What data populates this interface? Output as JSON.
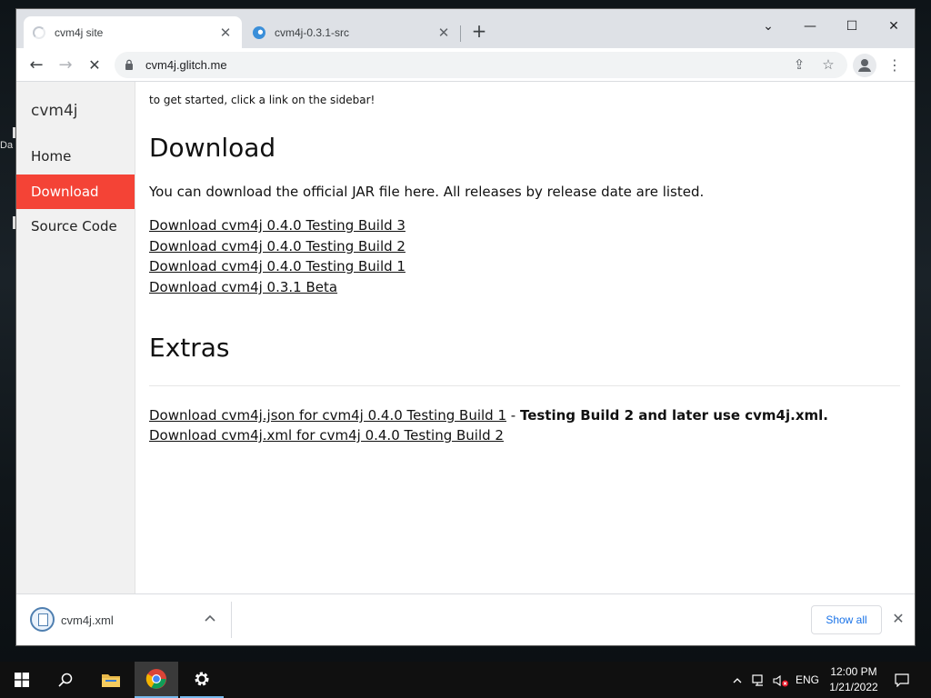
{
  "desktop": {
    "icon_label_fragment": "Da"
  },
  "browser": {
    "tabs": [
      {
        "title": "cvm4j site",
        "icon": "loading-spinner-icon",
        "close": "✕"
      },
      {
        "title": "cvm4j-0.3.1-src",
        "icon": "edge-icon",
        "close": "✕"
      }
    ],
    "new_tab": "+",
    "window_controls": {
      "tab_search": "⌄",
      "minimize": "—",
      "maximize": "☐",
      "close": "✕"
    },
    "nav": {
      "back": "←",
      "forward": "→",
      "stop": "✕"
    },
    "url": "cvm4j.glitch.me",
    "share_icon": "⇪",
    "star_icon": "☆",
    "menu_icon": "⋮"
  },
  "page": {
    "sidebar": {
      "brand": "cvm4j",
      "items": [
        {
          "label": "Home",
          "active": false
        },
        {
          "label": "Download",
          "active": true
        },
        {
          "label": "Source Code",
          "active": false
        }
      ],
      "active_color": "#f44336"
    },
    "intro": "to get started, click a link on the sidebar!",
    "download": {
      "heading": "Download",
      "text": "You can download the official JAR file here. All releases by release date are listed.",
      "links": [
        "Download cvm4j 0.4.0 Testing Build 3",
        "Download cvm4j 0.4.0 Testing Build 2",
        "Download cvm4j 0.4.0 Testing Build 1",
        "Download cvm4j 0.3.1 Beta"
      ]
    },
    "extras": {
      "heading": "Extras",
      "json_link": "Download cvm4j.json for cvm4j 0.4.0 Testing Build 1",
      "separator": " - ",
      "note": "Testing Build 2 and later use cvm4j.xml.",
      "xml_link": "Download cvm4j.xml for cvm4j 0.4.0 Testing Build 2"
    }
  },
  "download_shelf": {
    "file_name": "cvm4j.xml",
    "chevron": "^",
    "show_all": "Show all",
    "close": "✕"
  },
  "taskbar": {
    "language": "ENG",
    "time": "12:00 PM",
    "date": "1/21/2022",
    "tray_chevron": "^"
  }
}
